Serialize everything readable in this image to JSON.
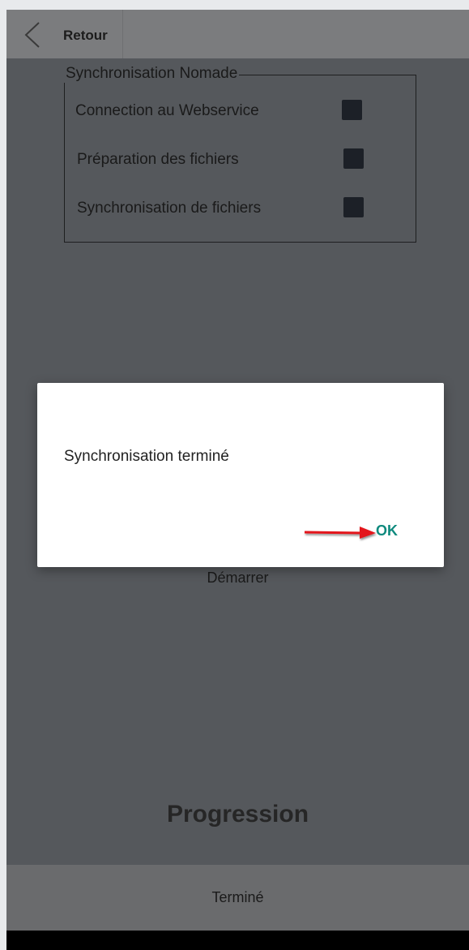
{
  "header": {
    "back_label": "Retour",
    "back_icon": "chevron-left-icon"
  },
  "sync_group": {
    "title": "Synchronisation Nomade",
    "rows": [
      {
        "label": "Connection au Webservice",
        "checked": true
      },
      {
        "label": "Préparation des fichiers",
        "checked": true
      },
      {
        "label": "Synchronisation de fichiers",
        "checked": true
      }
    ]
  },
  "main": {
    "start_label": "Démarrer",
    "progress_title": "Progression",
    "done_button": "Terminé"
  },
  "dialog": {
    "message": "Synchronisation terminé",
    "ok_label": "OK",
    "ok_color": "#0f8a7e",
    "annotation_arrow_color": "#e3141b"
  },
  "colors": {
    "screen_bg": "#55585c",
    "topbar_bg": "#7b7c7e",
    "footer_bg": "#6a6b6d",
    "checkbox": "#1c2027"
  }
}
